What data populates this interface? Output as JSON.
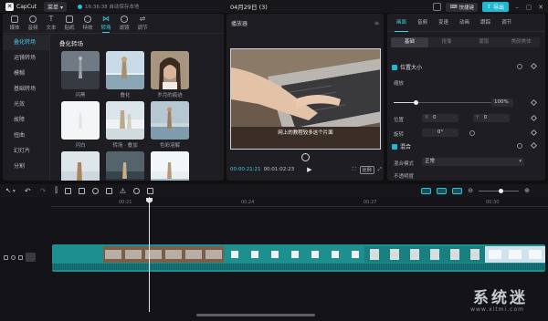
{
  "titlebar": {
    "app_name": "CapCut",
    "menu_label": "菜单",
    "autosave_text": "16:36:38 自动保存本地",
    "project_title": "04月29日 (3)",
    "shortcut_label": "快捷键",
    "export_label": "导出"
  },
  "media": {
    "tabs": [
      {
        "label": "媒体"
      },
      {
        "label": "音频"
      },
      {
        "label": "文本"
      },
      {
        "label": "贴纸"
      },
      {
        "label": "特效"
      },
      {
        "label": "转场"
      },
      {
        "label": "滤镜"
      },
      {
        "label": "调节"
      }
    ],
    "active_tab": "转场",
    "sidebar": [
      "叠化转场",
      "运镜转场",
      "模糊",
      "幻灯片",
      "光效",
      "拍摄",
      "扭曲",
      "故障",
      "分割"
    ],
    "sidebar_ordered": [
      "叠化转场",
      "运镜转场",
      "模糊",
      "基础转场",
      "光效",
      "故障",
      "扭曲",
      "幻灯片",
      "分割"
    ],
    "gallery_title": "叠化转场",
    "items": [
      {
        "label": "闪黑"
      },
      {
        "label": "叠化"
      },
      {
        "label": "岁月的痕迹"
      },
      {
        "label": "闪白"
      },
      {
        "label": "转场 · 叠加"
      },
      {
        "label": "色彩溶解"
      },
      {
        "label": ""
      },
      {
        "label": ""
      },
      {
        "label": ""
      }
    ]
  },
  "preview": {
    "title": "播放器",
    "subtitle": "网上的教程较多这个片面",
    "time_current": "00:00:21:21",
    "time_total": "00:01:02:23",
    "ratio_label": "比例"
  },
  "props": {
    "tabs": [
      "画面",
      "音频",
      "变速",
      "动画",
      "跟踪",
      "调节"
    ],
    "active_tab": "画面",
    "segments": [
      "基础",
      "抠像",
      "蒙版",
      "美颜美体"
    ],
    "position_size_label": "位置大小",
    "scale_label": "缩放",
    "scale_value": "100%",
    "position_label": "位置",
    "x_label": "X",
    "x_value": "0",
    "y_label": "Y",
    "y_value": "0",
    "rotate_label": "旋转",
    "rotate_value": "0°",
    "blend_label": "混合",
    "blend_mode_label": "混合模式",
    "blend_mode_value": "正常",
    "opacity_label": "不透明度",
    "scale_level": 0.2
  },
  "timeline": {
    "ticks": [
      "00:21",
      "00:24",
      "00:27",
      "00:30"
    ],
    "zoom_level": 0.55
  },
  "watermark": {
    "text": "系统迷",
    "url": "www.xitmi.com"
  },
  "colors": {
    "accent": "#3fd0e4",
    "export_bg": "#1fb8d2",
    "clip_bg": "#1e8f8f",
    "panel_bg": "#1d1d22"
  }
}
